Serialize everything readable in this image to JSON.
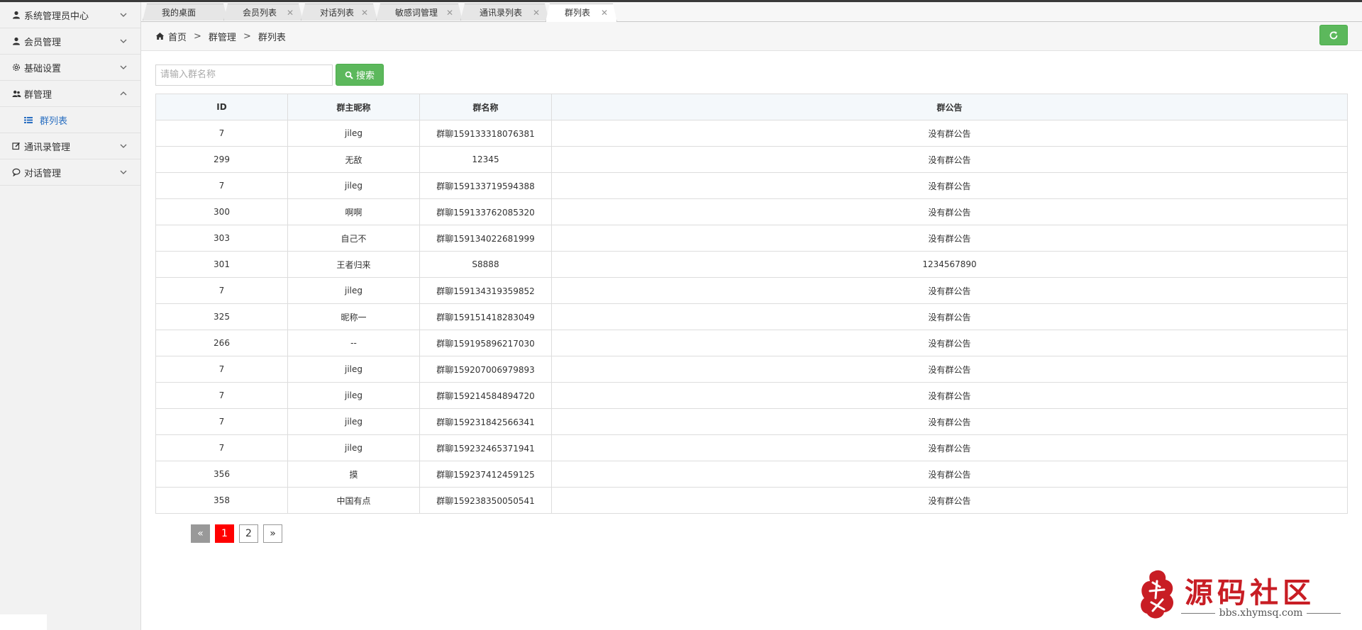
{
  "sidebar": {
    "items": [
      {
        "label": "系统管理员中心",
        "icon": "user-icon",
        "expanded": false
      },
      {
        "label": "会员管理",
        "icon": "user-icon",
        "expanded": false
      },
      {
        "label": "基础设置",
        "icon": "gear-icon",
        "expanded": false
      },
      {
        "label": "群管理",
        "icon": "users-icon",
        "expanded": true,
        "children": [
          {
            "label": "群列表",
            "icon": "list-icon"
          }
        ]
      },
      {
        "label": "通讯录管理",
        "icon": "edit-icon",
        "expanded": false
      },
      {
        "label": "对话管理",
        "icon": "chat-icon",
        "expanded": false
      }
    ]
  },
  "tabs": [
    {
      "label": "我的桌面",
      "closable": false
    },
    {
      "label": "会员列表",
      "closable": true
    },
    {
      "label": "对话列表",
      "closable": true
    },
    {
      "label": "敏感词管理",
      "closable": true
    },
    {
      "label": "通讯录列表",
      "closable": true
    },
    {
      "label": "群列表",
      "closable": true,
      "active": true
    }
  ],
  "breadcrumb": {
    "home": "首页",
    "sep": ">",
    "level1": "群管理",
    "level2": "群列表"
  },
  "search": {
    "placeholder": "请输入群名称",
    "value": "",
    "button_label": "搜索"
  },
  "table": {
    "columns": [
      "ID",
      "群主昵称",
      "群名称",
      "群公告"
    ],
    "rows": [
      [
        "7",
        "jileg",
        "群聊159133318076381",
        "没有群公告"
      ],
      [
        "299",
        "无敌",
        "12345",
        "没有群公告"
      ],
      [
        "7",
        "jileg",
        "群聊159133719594388",
        "没有群公告"
      ],
      [
        "300",
        "啊啊",
        "群聊159133762085320",
        "没有群公告"
      ],
      [
        "303",
        "自己不",
        "群聊159134022681999",
        "没有群公告"
      ],
      [
        "301",
        "王者归来",
        "S8888",
        "1234567890"
      ],
      [
        "7",
        "jileg",
        "群聊159134319359852",
        "没有群公告"
      ],
      [
        "325",
        "昵称一",
        "群聊159151418283049",
        "没有群公告"
      ],
      [
        "266",
        "--",
        "群聊159195896217030",
        "没有群公告"
      ],
      [
        "7",
        "jileg",
        "群聊159207006979893",
        "没有群公告"
      ],
      [
        "7",
        "jileg",
        "群聊159214584894720",
        "没有群公告"
      ],
      [
        "7",
        "jileg",
        "群聊159231842566341",
        "没有群公告"
      ],
      [
        "7",
        "jileg",
        "群聊159232465371941",
        "没有群公告"
      ],
      [
        "356",
        "摸",
        "群聊159237412459125",
        "没有群公告"
      ],
      [
        "358",
        "中国有点",
        "群聊159238350050541",
        "没有群公告"
      ]
    ]
  },
  "pagination": {
    "prev": "«",
    "pages": [
      "1",
      "2"
    ],
    "current": "1",
    "next": "»"
  },
  "watermark": {
    "title": "源码社区",
    "url": "bbs.xhymsq.com",
    "seal_text": "小猴"
  },
  "colors": {
    "accent_green": "#5cb85c",
    "active_link": "#2a6fc1",
    "page_current": "#ff0000",
    "watermark_red": "#c81d24"
  }
}
